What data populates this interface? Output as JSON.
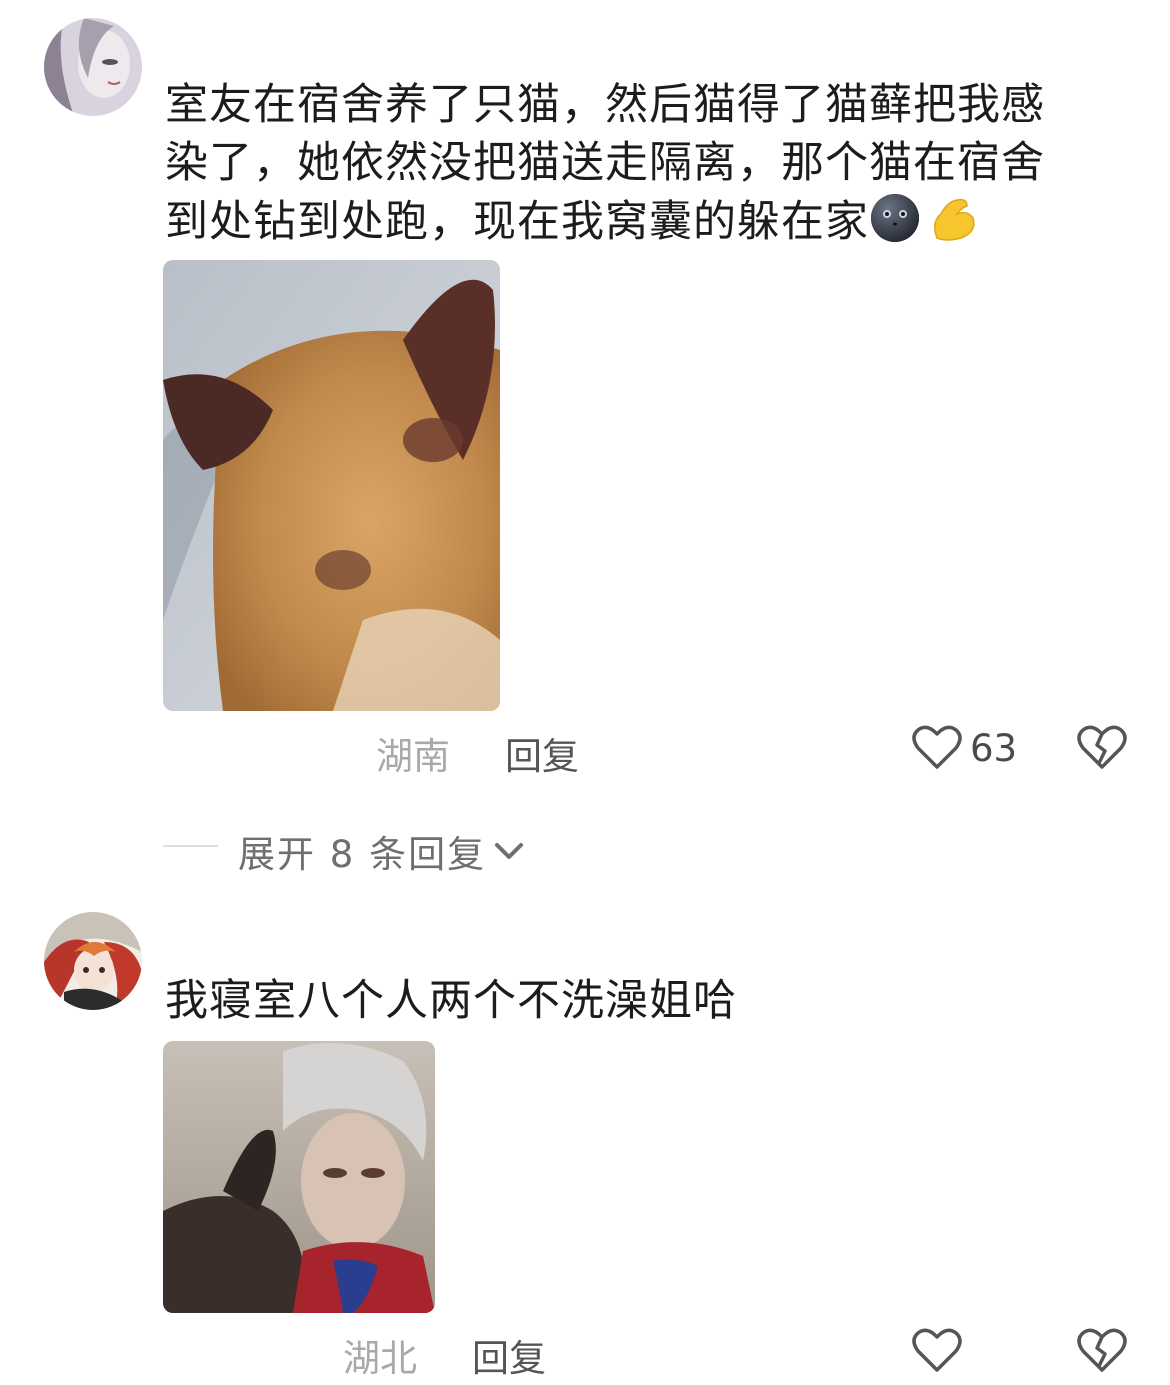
{
  "comments": [
    {
      "text_lines": [
        "室友在宿舍养了只猫，然后猫得了猫藓把我感",
        "染了，她依然没把猫送走隔离，那个猫在宿舍",
        "到处钻到处跑，现在我窝囊的躲在家"
      ],
      "emojis": [
        "moon-face-emoji",
        "flexed-biceps-emoji"
      ],
      "location": "湖南",
      "reply_label": "回复",
      "like_count": "63",
      "expand_replies": "展开 8 条回复"
    },
    {
      "text_lines": [
        "我寝室八个人两个不洗澡姐哈"
      ],
      "location": "湖北",
      "reply_label": "回复"
    }
  ],
  "icons": [
    "heart-outline-icon",
    "broken-heart-icon",
    "chevron-down-icon"
  ],
  "colors": {
    "text": "#1c1c1c",
    "meta": "#a9a9a9",
    "reply": "#555555"
  }
}
